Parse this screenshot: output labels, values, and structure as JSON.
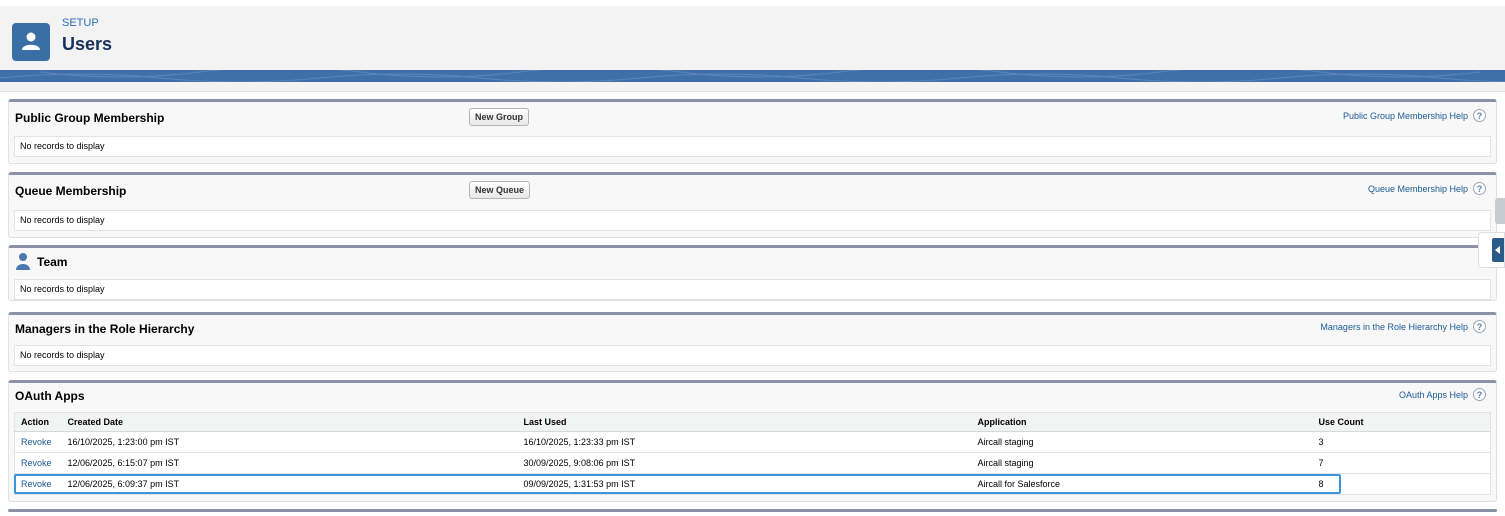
{
  "header": {
    "setup_label": "SETUP",
    "title": "Users"
  },
  "sections": {
    "public_group": {
      "title": "Public Group Membership",
      "button": "New Group",
      "help": "Public Group Membership Help",
      "empty": "No records to display"
    },
    "queue": {
      "title": "Queue Membership",
      "button": "New Queue",
      "help": "Queue Membership Help",
      "empty": "No records to display"
    },
    "team": {
      "title": "Team",
      "empty": "No records to display"
    },
    "managers": {
      "title": "Managers in the Role Hierarchy",
      "help": "Managers in the Role Hierarchy Help",
      "empty": "No records to display"
    },
    "oauth": {
      "title": "OAuth Apps",
      "help": "OAuth Apps Help",
      "columns": [
        "Action",
        "Created Date",
        "Last Used",
        "Application",
        "Use Count"
      ],
      "rows": [
        {
          "action": "Revoke",
          "created": "16/10/2025, 1:23:00 pm IST",
          "last_used": "16/10/2025, 1:23:33 pm IST",
          "application": "Aircall staging",
          "use_count": "3"
        },
        {
          "action": "Revoke",
          "created": "12/06/2025, 6:15:07 pm IST",
          "last_used": "30/09/2025, 9:08:06 pm IST",
          "application": "Aircall staging",
          "use_count": "7"
        },
        {
          "action": "Revoke",
          "created": "12/06/2025, 6:09:37 pm IST",
          "last_used": "09/09/2025, 1:31:53 pm IST",
          "application": "Aircall for Salesforce",
          "use_count": "8"
        }
      ]
    }
  },
  "icons": {
    "help": "?",
    "header": "user-icon",
    "team": "person-icon"
  },
  "colors": {
    "accent": "#3a6fa5",
    "link": "#1a5a96",
    "highlight": "#3a95e0"
  }
}
